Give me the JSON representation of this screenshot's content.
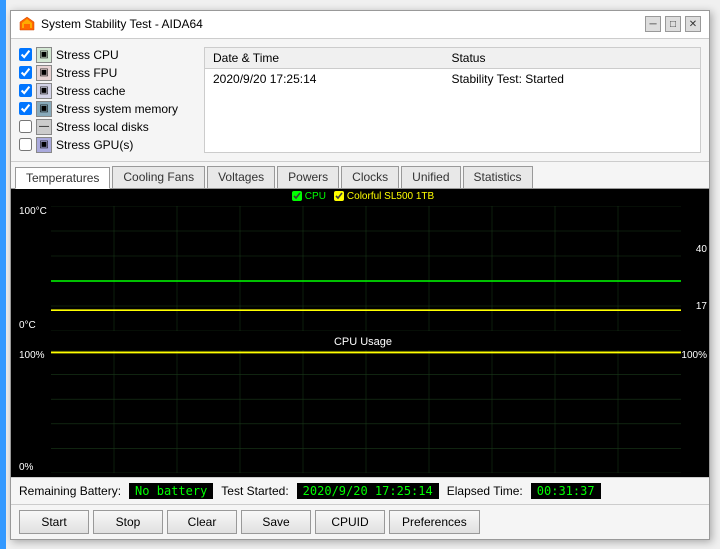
{
  "window": {
    "title": "System Stability Test - AIDA64"
  },
  "checkboxes": [
    {
      "id": "stress_cpu",
      "label": "Stress CPU",
      "checked": true,
      "icon": "cpu"
    },
    {
      "id": "stress_fpu",
      "label": "Stress FPU",
      "checked": true,
      "icon": "fpu"
    },
    {
      "id": "stress_cache",
      "label": "Stress cache",
      "checked": true,
      "icon": "cache"
    },
    {
      "id": "stress_mem",
      "label": "Stress system memory",
      "checked": true,
      "icon": "mem"
    },
    {
      "id": "stress_disk",
      "label": "Stress local disks",
      "checked": false,
      "icon": "disk"
    },
    {
      "id": "stress_gpu",
      "label": "Stress GPU(s)",
      "checked": false,
      "icon": "gpu"
    }
  ],
  "status_table": {
    "headers": [
      "Date & Time",
      "Status"
    ],
    "rows": [
      {
        "datetime": "2020/9/20 17:25:14",
        "status": "Stability Test: Started"
      }
    ]
  },
  "tabs": [
    {
      "id": "temperatures",
      "label": "Temperatures",
      "active": true
    },
    {
      "id": "cooling_fans",
      "label": "Cooling Fans",
      "active": false
    },
    {
      "id": "voltages",
      "label": "Voltages",
      "active": false
    },
    {
      "id": "powers",
      "label": "Powers",
      "active": false
    },
    {
      "id": "clocks",
      "label": "Clocks",
      "active": false
    },
    {
      "id": "unified",
      "label": "Unified",
      "active": false
    },
    {
      "id": "statistics",
      "label": "Statistics",
      "active": false
    }
  ],
  "temp_chart": {
    "title": "",
    "legend": [
      {
        "label": "CPU",
        "color": "#00ff00"
      },
      {
        "label": "Colorful SL500 1TB",
        "color": "#ffff00"
      }
    ],
    "y_top": "100°C",
    "y_bottom": "0°C",
    "right_labels": [
      "40",
      "17"
    ],
    "cpu_value": 40,
    "disk_value": 17
  },
  "usage_chart": {
    "title": "CPU Usage",
    "y_top": "100%",
    "y_bottom": "0%",
    "right_label": "100%",
    "value": 100
  },
  "bottom_info": {
    "battery_label": "Remaining Battery:",
    "battery_value": "No battery",
    "test_started_label": "Test Started:",
    "test_started_value": "2020/9/20 17:25:14",
    "elapsed_label": "Elapsed Time:",
    "elapsed_value": "00:31:37"
  },
  "buttons": [
    {
      "id": "start",
      "label": "Start"
    },
    {
      "id": "stop",
      "label": "Stop"
    },
    {
      "id": "clear",
      "label": "Clear"
    },
    {
      "id": "save",
      "label": "Save"
    },
    {
      "id": "cpuid",
      "label": "CPUID"
    },
    {
      "id": "preferences",
      "label": "Preferences"
    }
  ]
}
